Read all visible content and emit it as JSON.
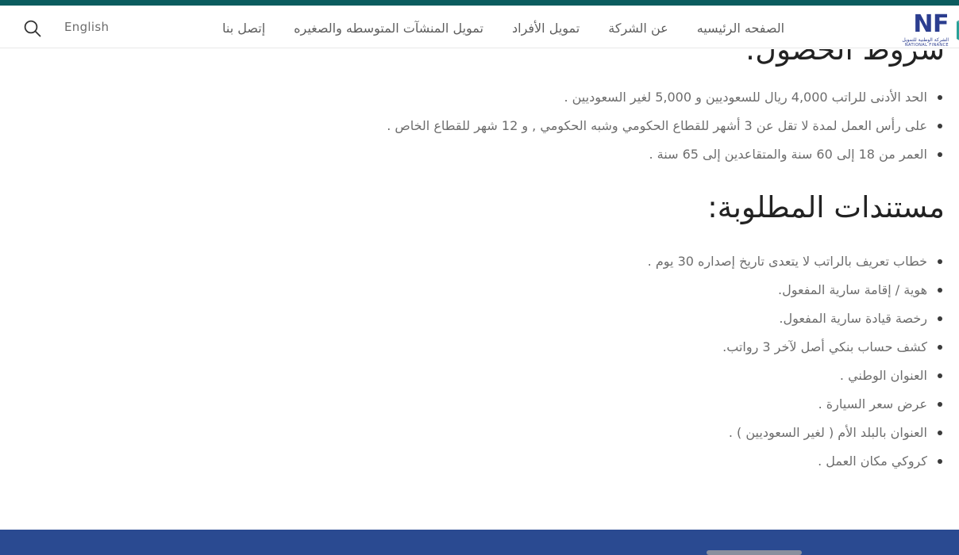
{
  "header": {
    "search_icon": "search-icon",
    "language_label": "English",
    "nav_items": [
      {
        "label": "الصفحه الرئيسيه"
      },
      {
        "label": "عن الشركة"
      },
      {
        "label": "تمويل الأفراد"
      },
      {
        "label": "تمويل المنشآت المتوسطه والصغيره"
      },
      {
        "label": "إتصل بنا"
      }
    ],
    "brand": {
      "mark": "nfc-n-logo-icon",
      "name": "NF",
      "subtitle_ar": "الشركة الوطنية للتمويل",
      "subtitle_en": "NATIONAL FINANCE"
    }
  },
  "main": {
    "conditions_title": "شروط الحصول:",
    "conditions": [
      "الحد الأدنى للراتب 4,000 ريال للسعوديين و 5,000 لغير السعوديين .",
      "على رأس العمل لمدة لا تقل عن 3 أشهر للقطاع الحكومي وشبه الحكومي , و 12 شهر للقطاع الخاص .",
      "العمر من 18 إلى 60 سنة والمتقاعدين إلى 65 سنة ."
    ],
    "documents_title": "مستندات المطلوبة:",
    "documents": [
      "خطاب تعريف بالراتب لا يتعدى تاريخ إصداره 30 يوم .",
      "هوية / إقامة سارية المفعول.",
      "رخصة قيادة سارية المفعول.",
      "كشف حساب بنكي أصل لآخر 3 رواتب.",
      "العنوان الوطني .",
      "عرض سعر السيارة .",
      "العنوان بالبلد الأم ( لغير السعوديين ) .",
      "كروكي مكان العمل ."
    ]
  },
  "footer": {
    "band_color": "#2a4a91"
  },
  "colors": {
    "top_strip": "#0b5c5f",
    "brand_blue": "#2b3d8f",
    "brand_teal": "#2aa198",
    "body_text": "#6d6d6d",
    "heading_text": "#222222"
  }
}
